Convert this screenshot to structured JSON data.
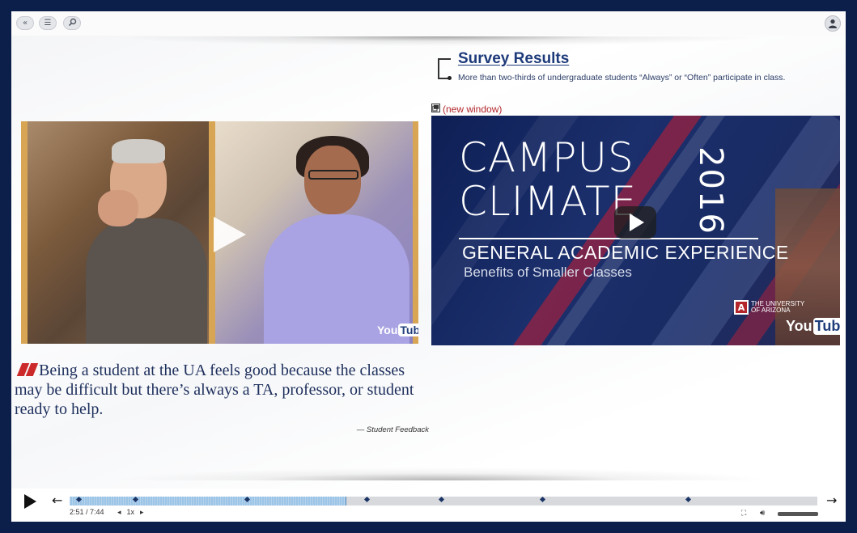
{
  "toolbar": {
    "back_icon": "«",
    "menu_icon": "☰",
    "search_icon": "⚲",
    "user_icon": "user-icon"
  },
  "survey": {
    "title": "Survey Results",
    "subtitle": "More than two-thirds of undergraduate students “Always” or “Often” participate in class."
  },
  "new_window_link": "(new window)",
  "video_left": {
    "youtube_you": "You",
    "youtube_tube": "Tube"
  },
  "video_right": {
    "title_line1": "CAMPUS",
    "title_line2": "CLIMATE",
    "year": "2016",
    "subtitle": "GENERAL ACADEMIC EXPERIENCE",
    "subtitle2": "Benefits of Smaller Classes",
    "ua_line1": "THE UNIVERSITY",
    "ua_line2": "OF ARIZONA",
    "youtube_you": "You",
    "youtube_tube": "Tube"
  },
  "quote": {
    "text": "Being a student at the UA feels good because the classes may be difficult but there’s always a TA, professor, or student ready to help.",
    "attribution": "— Student Feedback"
  },
  "player": {
    "time": "2:51 / 7:44",
    "rate": "1x",
    "progress": 0.37,
    "markers": [
      0.01,
      0.085,
      0.235,
      0.395,
      0.495,
      0.63,
      0.825
    ]
  }
}
